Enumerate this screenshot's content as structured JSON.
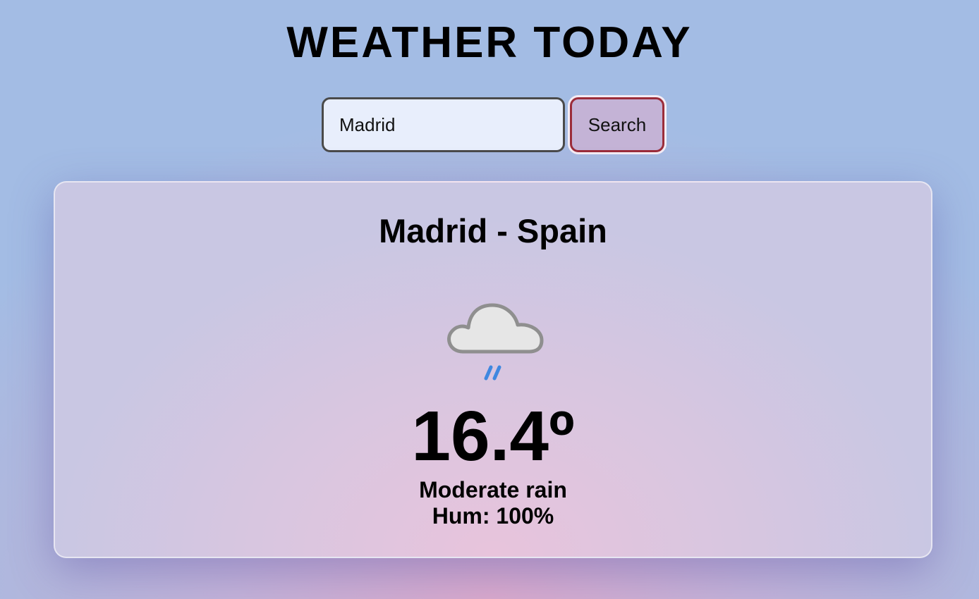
{
  "header": {
    "title": "WEATHER TODAY"
  },
  "search": {
    "value": "Madrid",
    "button_label": "Search"
  },
  "weather": {
    "location": "Madrid - Spain",
    "icon": "rain-cloud-icon",
    "temperature": "16.4º",
    "condition": "Moderate rain",
    "humidity_label": "Hum:",
    "humidity_value": "100%"
  },
  "colors": {
    "input_border": "#4a4a4a",
    "button_border": "#9b2c3a",
    "rain_blue": "#3f88e0"
  }
}
